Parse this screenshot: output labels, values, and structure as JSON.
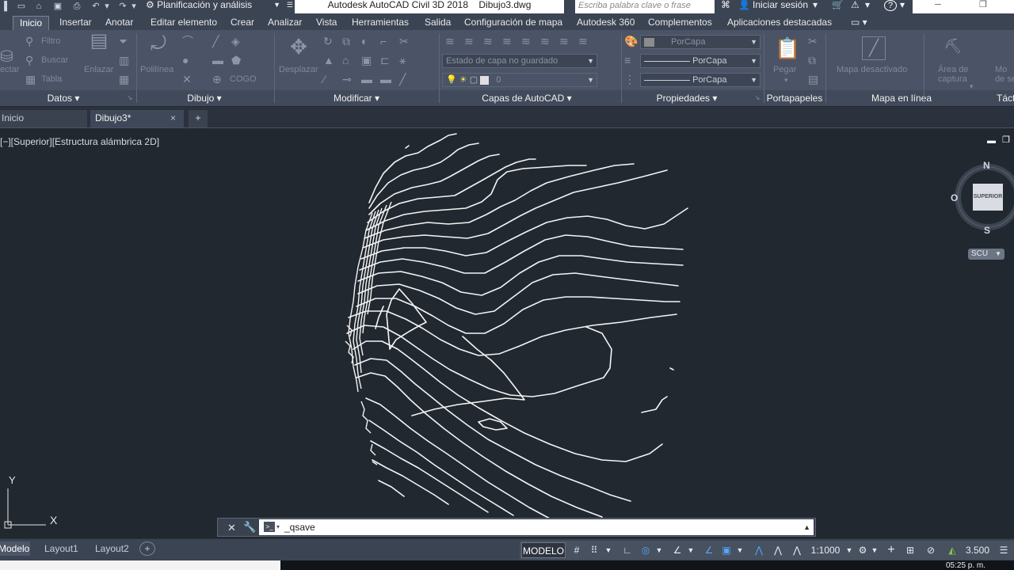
{
  "title_bar": {
    "workspace": "Planificación y análisis",
    "app_title": "Autodesk AutoCAD Civil 3D 2018",
    "file_name": "Dibujo3.dwg",
    "search_placeholder": "Escriba palabra clave o frase",
    "sign_in": "Iniciar sesión",
    "help": "?"
  },
  "menu_tabs": [
    {
      "label": "Inicio",
      "active": true
    },
    {
      "label": "Insertar"
    },
    {
      "label": "Anotar"
    },
    {
      "label": "Editar elemento"
    },
    {
      "label": "Crear"
    },
    {
      "label": "Analizar"
    },
    {
      "label": "Vista"
    },
    {
      "label": "Herramientas"
    },
    {
      "label": "Salida"
    },
    {
      "label": "Configuración de mapa"
    },
    {
      "label": "Autodesk 360"
    },
    {
      "label": "Complementos"
    },
    {
      "label": "Aplicaciones destacadas"
    }
  ],
  "ribbon": {
    "datos": {
      "title": "Datos",
      "connect": "ectar",
      "filtro": "Filtro",
      "buscar": "Buscar",
      "tabla": "Tabla",
      "enlazar": "Enlazar"
    },
    "dibujo": {
      "title": "Dibujo",
      "polilinea": "Polilínea",
      "cogo": "COGO"
    },
    "modificar": {
      "title": "Modificar",
      "desplazar": "Desplazar"
    },
    "capas": {
      "title": "Capas de AutoCAD",
      "layer_state": "Estado de capa no guardado",
      "current_layer": "0"
    },
    "propiedades": {
      "title": "Propiedades",
      "color": "PorCapa",
      "linetype": "PorCapa",
      "lineweight": "PorCapa"
    },
    "portapapeles": {
      "title": "Portapapeles",
      "pegar": "Pegar"
    },
    "mapa": {
      "title": "Mapa en línea",
      "label": "Mapa desactivado"
    },
    "captura": {
      "title": "Táct",
      "label1": "Área de",
      "label2": "captura",
      "label3": "Mo",
      "label4": "de sele"
    }
  },
  "file_tabs": {
    "home": "Inicio",
    "drawing": "Dibujo3*",
    "close": "×",
    "add": "+"
  },
  "viewport": {
    "label": "[−][Superior][Estructura alámbrica 2D]",
    "minimize": "▬",
    "maximize": "❐"
  },
  "viewcube": {
    "north": "N",
    "south": "S",
    "west": "O",
    "face": "SUPERIOR",
    "ucs": "SCU"
  },
  "ucs_icon": {
    "y": "Y",
    "x": "X"
  },
  "command_line": {
    "text": "_qsave"
  },
  "layout_tabs": [
    "Modelo",
    "Layout1",
    "Layout2"
  ],
  "status_bar": {
    "model": "MODELO",
    "scale": "1:1000",
    "annotation_value": "3.500"
  },
  "taskbar": {
    "clock": "05:25 p. m."
  }
}
